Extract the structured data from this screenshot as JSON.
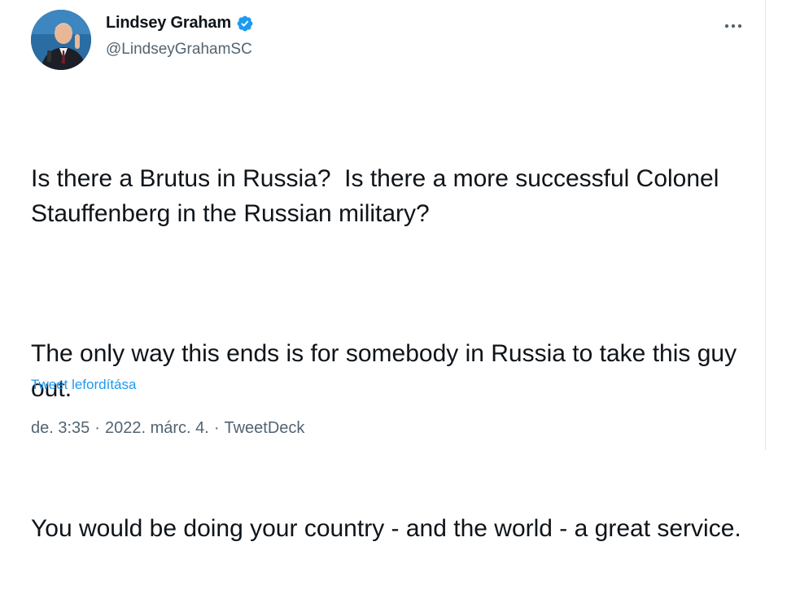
{
  "tweet": {
    "author": {
      "display_name": "Lindsey Graham",
      "handle": "@LindseyGrahamSC",
      "verified": true
    },
    "paragraphs": [
      "Is there a Brutus in Russia?  Is there a more successful Colonel Stauffenberg in the Russian military?",
      "The only way this ends is for somebody in Russia to take this guy out.",
      "You would be doing your country - and the world - a great service."
    ],
    "translate_label": "Tweet lefordítása",
    "meta": {
      "time": "de. 3:35",
      "separator_1": "·",
      "date": "2022. márc. 4.",
      "separator_2": "·",
      "source": "TweetDeck"
    }
  },
  "colors": {
    "accent": "#1d9bf0",
    "text_primary": "#0f1419",
    "text_secondary": "#536471"
  },
  "icons": {
    "verified": "verified-badge-icon",
    "more": "more-options-icon"
  }
}
